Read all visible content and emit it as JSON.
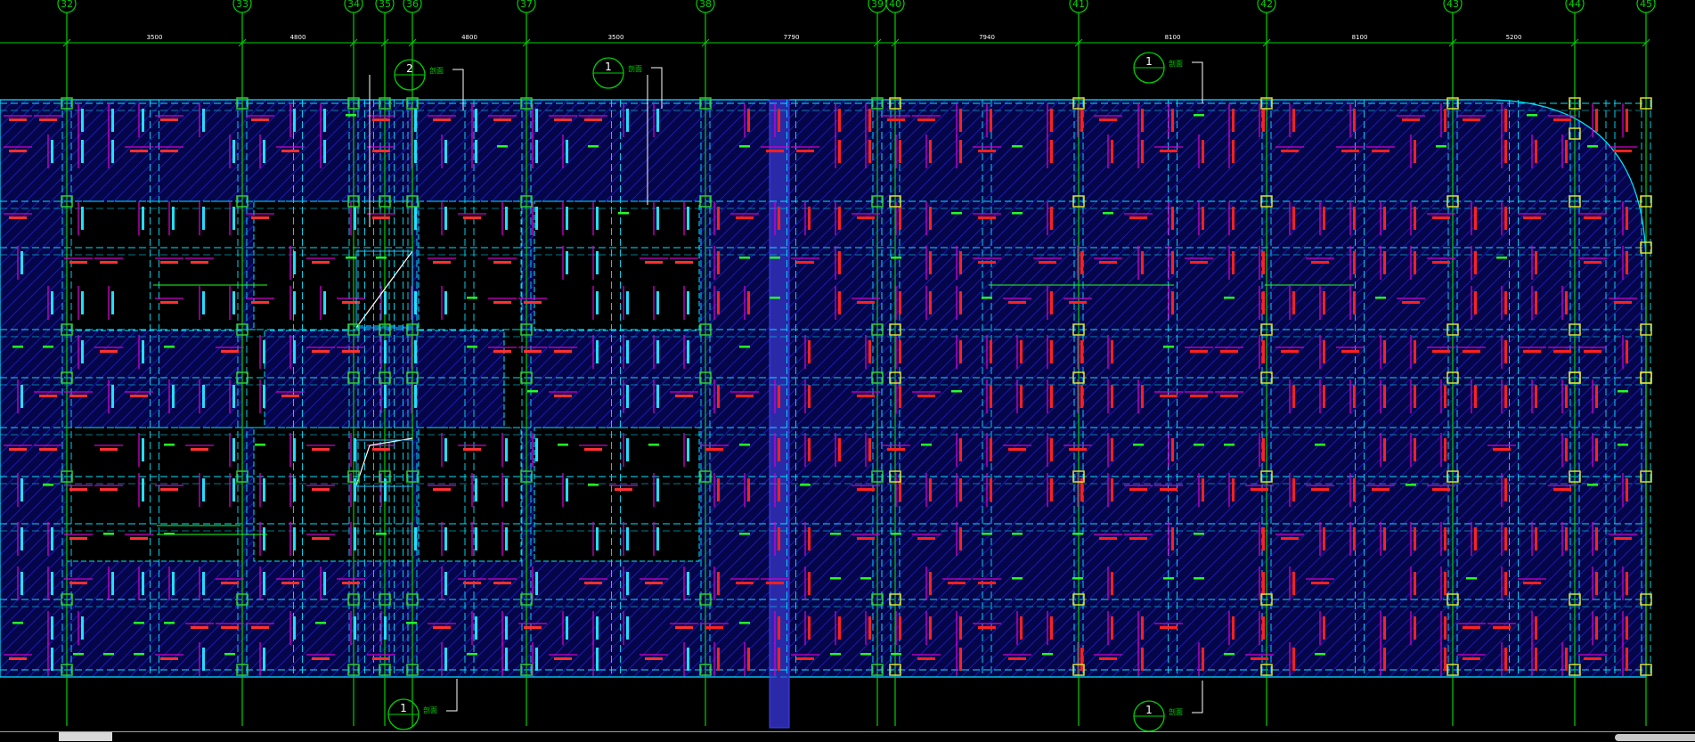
{
  "colors": {
    "background": "#000000",
    "slab_hatch": "#1c1cc8",
    "slab_fill": "#05054a",
    "beam_dash": "#00e5ff",
    "axis": "#00d000",
    "column": "#33cc33",
    "column_edge": "#e0e030",
    "rebar_magenta": "#d000d0",
    "label_red": "#ff2020",
    "label_green": "#22ff22",
    "outline_white": "#ffffff",
    "pier_strip": "#2a2aa8"
  },
  "grid_axes": [
    {
      "label": "32"
    },
    {
      "label": "33"
    },
    {
      "label": "34"
    },
    {
      "label": "35"
    },
    {
      "label": "36"
    },
    {
      "label": "37"
    },
    {
      "label": "38"
    },
    {
      "label": "39"
    },
    {
      "label": "40"
    },
    {
      "label": "41"
    },
    {
      "label": "42"
    },
    {
      "label": "43"
    },
    {
      "label": "44"
    },
    {
      "label": "45"
    }
  ],
  "dimensions": [
    "3500",
    "4800",
    "4800",
    "3500",
    "7790",
    "7940",
    "8100",
    "8100",
    "5200"
  ],
  "section_markers": [
    {
      "id": "2",
      "note": "剖面"
    },
    {
      "id": "1",
      "note": "剖面"
    },
    {
      "id": "1",
      "note": "剖面"
    },
    {
      "id": "1",
      "note": "剖面"
    },
    {
      "id": "1",
      "note": "剖面"
    }
  ]
}
